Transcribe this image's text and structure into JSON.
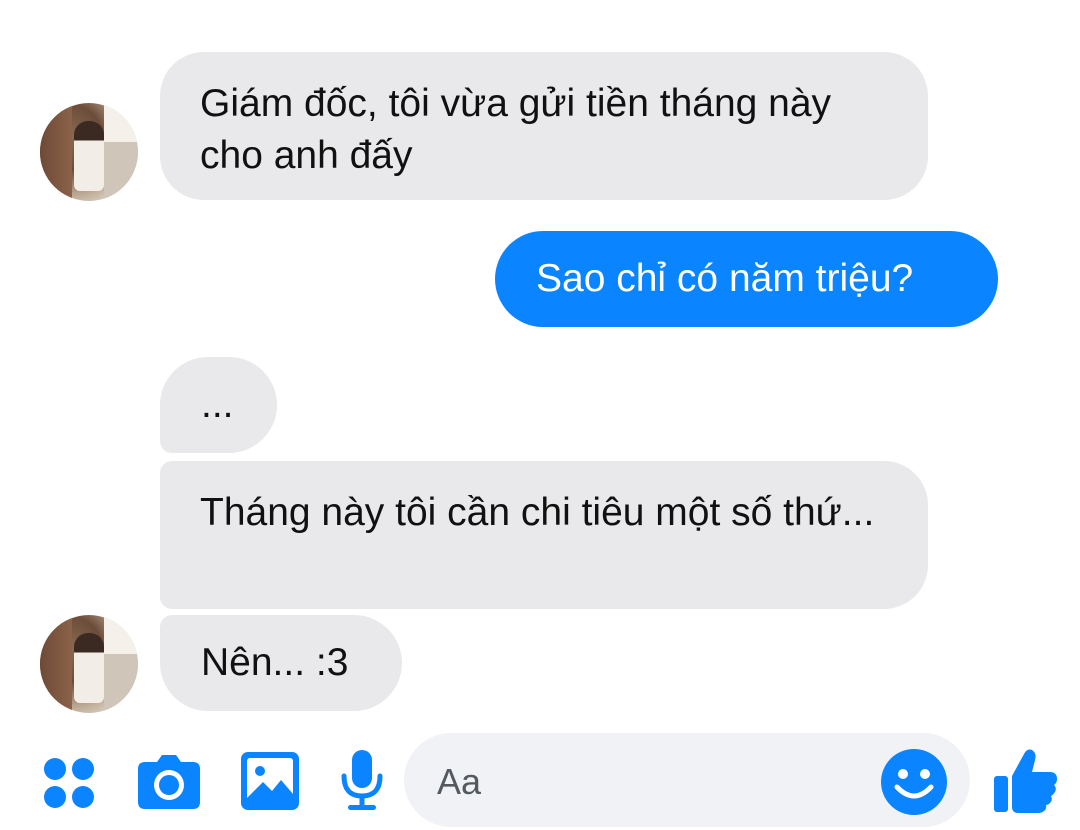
{
  "conversation": {
    "messages": [
      {
        "sender": "them",
        "text": "Giám đốc, tôi vừa gửi tiền tháng này cho anh đấy"
      },
      {
        "sender": "me",
        "text": "Sao chỉ có năm triệu?"
      },
      {
        "sender": "them",
        "text": "..."
      },
      {
        "sender": "them",
        "text": "Tháng này tôi cần chi tiêu một số thứ..."
      },
      {
        "sender": "them",
        "text": "Nên... :3"
      }
    ]
  },
  "composer": {
    "placeholder": "Aa",
    "icons": [
      "apps-icon",
      "camera-icon",
      "gallery-icon",
      "mic-icon",
      "emoji-icon",
      "thumbs-up-icon"
    ]
  },
  "colors": {
    "accent": "#0a84ff",
    "incoming_bubble": "#e9e9eb",
    "outgoing_text": "#ffffff",
    "input_background": "#f0f2f5"
  }
}
